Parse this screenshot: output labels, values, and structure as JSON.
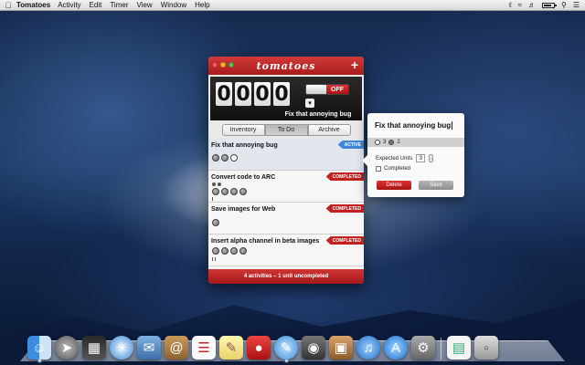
{
  "menubar": {
    "app_name": "Tomatoes",
    "menus": [
      "Activity",
      "Edit",
      "Timer",
      "View",
      "Window",
      "Help"
    ],
    "battery_level": 0.8
  },
  "window": {
    "title": "tomatoes",
    "add_icon": "plus-icon",
    "timer": {
      "digits": [
        "0",
        "0",
        "0",
        "0"
      ],
      "toggle_label": "OFF",
      "current_task": "Fix that annoying bug"
    },
    "tabs": [
      "Inventory",
      "To Do",
      "Archive"
    ],
    "active_tab": "To Do",
    "items": [
      {
        "title": "Fix that annoying bug",
        "badge": "ACTIVE"
      },
      {
        "title": "Convert code to ARC",
        "badge": "COMPLETED"
      },
      {
        "title": "Save images for Web",
        "badge": "COMPLETED"
      },
      {
        "title": "Insert alpha channel in beta images",
        "badge": "COMPLETED"
      }
    ],
    "footer": "4 activities – 1 unit uncompleted"
  },
  "popover": {
    "title": "Fix that annoying bug",
    "strip_a": "3",
    "strip_b": "2",
    "units_label": "Expected Units",
    "units_value": "3",
    "completed_label": "Completed",
    "delete_label": "Delete",
    "save_label": "Save"
  },
  "dock": {
    "icons": [
      "finder-icon",
      "launchpad-icon",
      "mission-control-icon",
      "safari-icon",
      "mail-icon",
      "contacts-icon",
      "calendar-icon",
      "notes-icon",
      "tomatoes-icon",
      "messages-icon",
      "facetime-icon",
      "photo-booth-icon",
      "itunes-icon",
      "app-store-icon",
      "system-preferences-icon",
      "document-icon",
      "trash-icon"
    ]
  },
  "colors": {
    "accent_red": "#c32020",
    "active_blue": "#3d86d8"
  }
}
